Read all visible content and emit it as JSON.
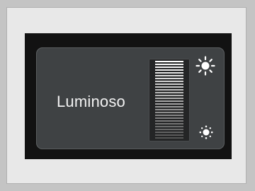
{
  "brightness_dialog": {
    "label": "Luminoso",
    "level_fraction": 1.0,
    "icons": {
      "high": "sun-bright-icon",
      "low": "sun-dim-icon"
    }
  },
  "colors": {
    "bar_top": "#ffffff",
    "bar_bottom": "#555555",
    "panel": "#3f4244",
    "screen": "#121212"
  }
}
